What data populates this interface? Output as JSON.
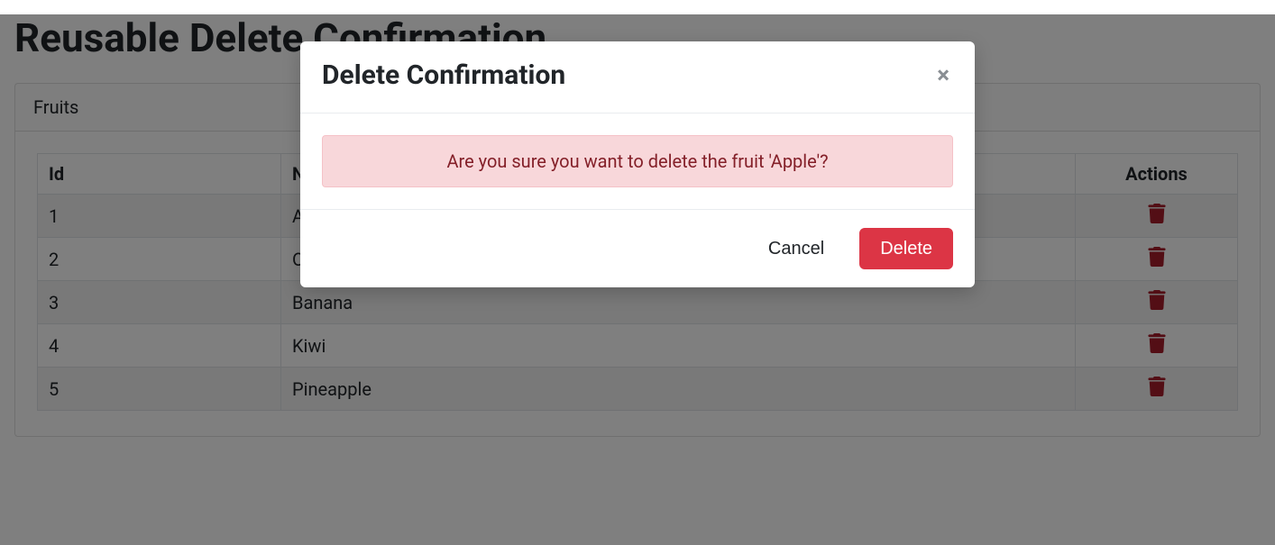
{
  "page": {
    "title": "Reusable Delete Confirmation"
  },
  "card": {
    "header": "Fruits"
  },
  "table": {
    "headers": {
      "id": "Id",
      "name": "Name",
      "actions": "Actions"
    },
    "rows": [
      {
        "id": "1",
        "name": "Apple"
      },
      {
        "id": "2",
        "name": "Orange"
      },
      {
        "id": "3",
        "name": "Banana"
      },
      {
        "id": "4",
        "name": "Kiwi"
      },
      {
        "id": "5",
        "name": "Pineapple"
      }
    ]
  },
  "modal": {
    "title": "Delete Confirmation",
    "message": "Are you sure you want to delete the fruit 'Apple'?",
    "cancel": "Cancel",
    "delete": "Delete"
  }
}
